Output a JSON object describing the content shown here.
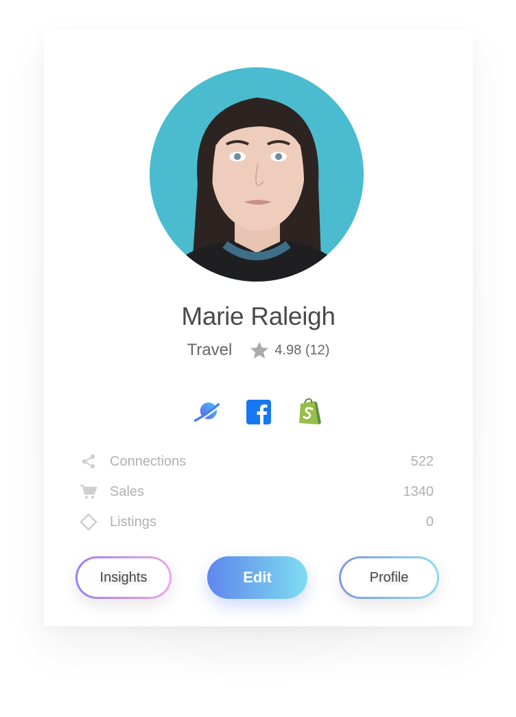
{
  "profile": {
    "name": "Marie Raleigh",
    "category": "Travel",
    "rating": "4.98 (12)"
  },
  "socials": [
    {
      "icon": "planet-icon"
    },
    {
      "icon": "facebook-icon"
    },
    {
      "icon": "shopify-icon"
    }
  ],
  "stats": [
    {
      "icon": "share-icon",
      "label": "Connections",
      "value": "522"
    },
    {
      "icon": "cart-icon",
      "label": "Sales",
      "value": "1340"
    },
    {
      "icon": "diamond-icon",
      "label": "Listings",
      "value": "0"
    }
  ],
  "buttons": {
    "insights": "Insights",
    "edit": "Edit",
    "profile": "Profile"
  },
  "colors": {
    "avatar_background": "#4bbccf",
    "edit_gradient_start": "#5e86ec",
    "edit_gradient_end": "#7fdcf2",
    "facebook_blue": "#1877f2",
    "shopify_green": "#95bf47"
  }
}
